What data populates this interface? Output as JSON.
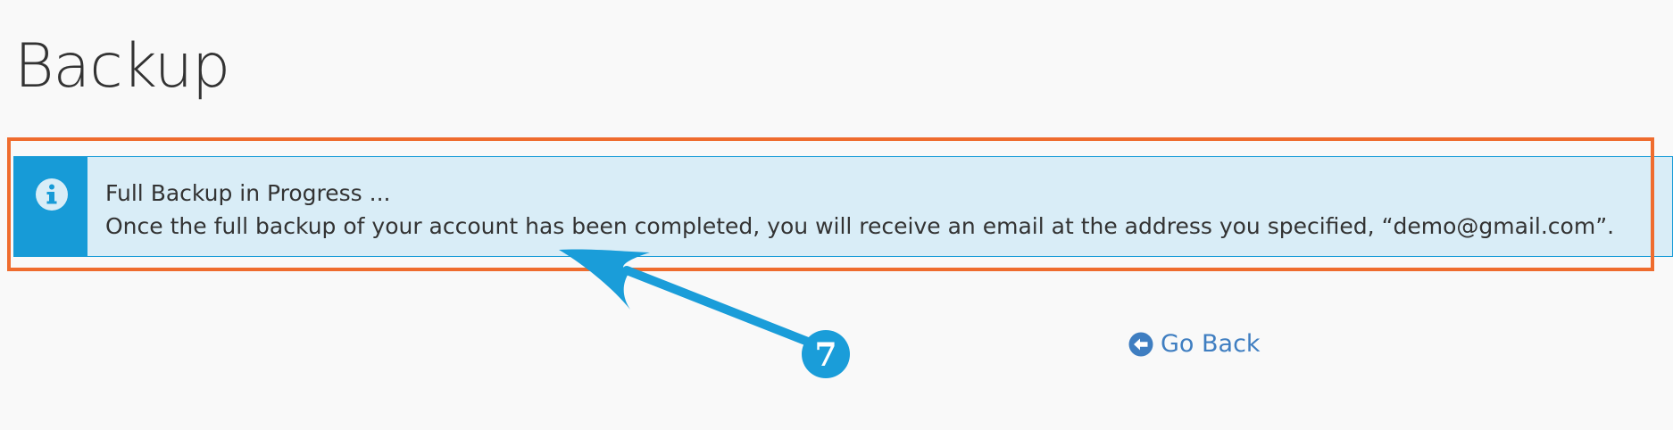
{
  "page": {
    "title": "Backup"
  },
  "alert": {
    "icon": "info-circle-icon",
    "heading": "Full Backup in Progress ...",
    "message": "Once the full backup of your account has been completed, you will receive an email at the address you specified, “demo@gmail.com”."
  },
  "navigation": {
    "go_back_icon": "arrow-circle-left-icon",
    "go_back_label": "Go Back"
  },
  "annotation": {
    "step_number": "7"
  },
  "colors": {
    "alert_accent": "#179bd7",
    "alert_background": "#d9edf7",
    "highlight_frame": "#ef6c2e",
    "link": "#3f7ec1",
    "annotation_arrow": "#1a9dd9"
  }
}
